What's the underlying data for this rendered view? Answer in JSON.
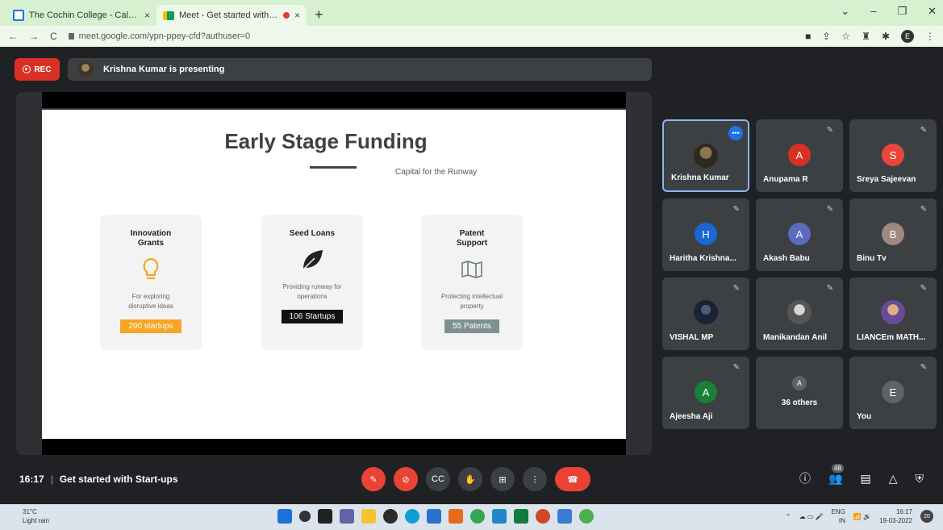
{
  "browser": {
    "tabs": [
      {
        "title": "The Cochin College - Calendar -",
        "close": "×"
      },
      {
        "title": "Meet - Get started with Star",
        "close": "×"
      }
    ],
    "new_tab": "+",
    "url": "meet.google.com/ypn-ppey-cfd?authuser=0",
    "profile_initial": "E"
  },
  "meet": {
    "rec_label": "REC",
    "presenting_text": "Krishna Kumar is presenting",
    "slide": {
      "title": "Early Stage Funding",
      "subtitle": "Capital for the Runway",
      "cards": [
        {
          "title": "Innovation Grants",
          "desc": "For exploring disruptive ideas",
          "tag": "290 startups",
          "icon": "lightbulb-icon"
        },
        {
          "title": "Seed Loans",
          "desc": "Providing runway for operations",
          "tag": "106 Startups",
          "icon": "leaf-icon"
        },
        {
          "title": "Patent Support",
          "desc": "Protecting intellectual property",
          "tag": "55 Patents",
          "icon": "map-icon"
        }
      ]
    },
    "participants": [
      {
        "name": "Krishna Kumar",
        "kind": "photo"
      },
      {
        "name": "Anupama R",
        "initial": "A",
        "color": "#d93025"
      },
      {
        "name": "Sreya Sajeevan",
        "initial": "S",
        "color": "#e8453c"
      },
      {
        "name": "Haritha Krishna...",
        "initial": "H",
        "color": "#1967d2"
      },
      {
        "name": "Akash Babu",
        "initial": "A",
        "color": "#5c6bc0"
      },
      {
        "name": "Binu Tv",
        "initial": "B",
        "color": "#a1887f"
      },
      {
        "name": "VISHAL MP",
        "kind": "photo"
      },
      {
        "name": "Manikandan Anil",
        "kind": "photo"
      },
      {
        "name": "LIANCEm MATH...",
        "kind": "photo"
      },
      {
        "name": "Ajeesha Aji",
        "initial": "A",
        "color": "#188038"
      },
      {
        "others_label": "36 others",
        "initial": "A"
      },
      {
        "name": "You",
        "initial": "E",
        "color": "#5f6368"
      }
    ],
    "time": "16:17",
    "meeting_title": "Get started with Start-ups",
    "people_count": "48"
  },
  "taskbar": {
    "temp": "31°C",
    "weather": "Light rain",
    "lang": "ENG",
    "region": "IN",
    "clock_time": "16:17",
    "clock_date": "19-03-2022",
    "notif_count": "20"
  }
}
